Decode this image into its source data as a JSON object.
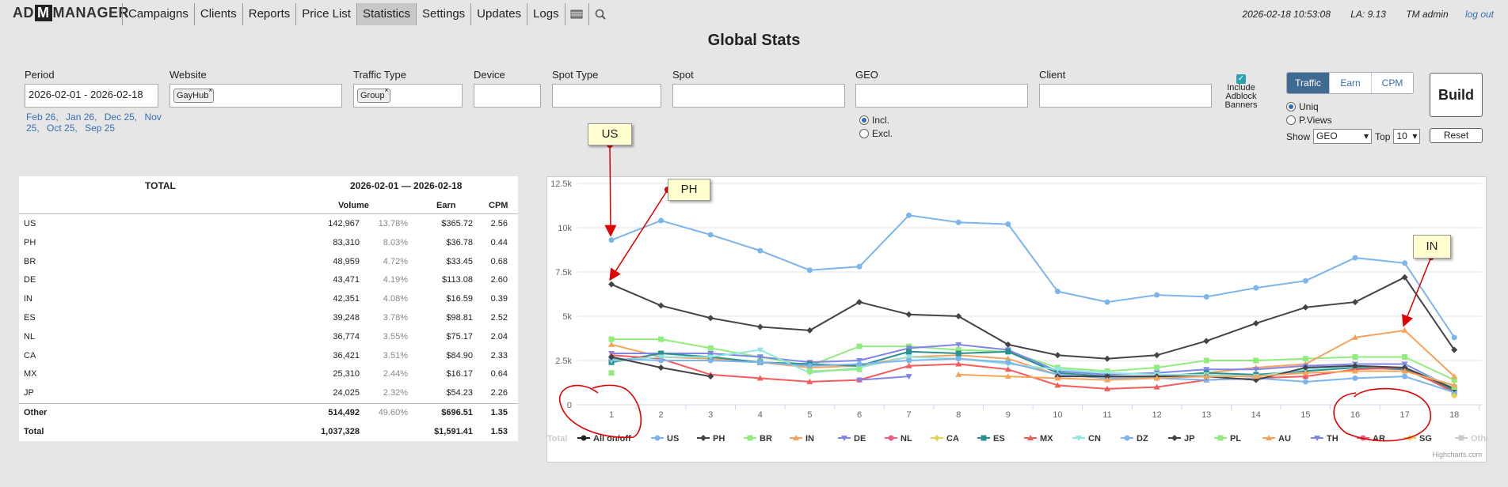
{
  "logo": {
    "pre": "AD",
    "mid": "M",
    "post": "MANAGER"
  },
  "nav": [
    {
      "label": "Campaigns",
      "active": false
    },
    {
      "label": "Clients",
      "active": false
    },
    {
      "label": "Reports",
      "active": false
    },
    {
      "label": "Price List",
      "active": false
    },
    {
      "label": "Statistics",
      "active": true
    },
    {
      "label": "Settings",
      "active": false
    },
    {
      "label": "Updates",
      "active": false
    },
    {
      "label": "Logs",
      "active": false
    }
  ],
  "nav_icons": [
    "table-icon",
    "search-icon"
  ],
  "header": {
    "datetime": "2026-02-18 10:53:08",
    "load": "LA: 9.13",
    "user": "TM admin",
    "logout": "log out"
  },
  "page_title": "Global Stats",
  "filters": {
    "period": {
      "label": "Period",
      "value": "2026-02-01 - 2026-02-18"
    },
    "website": {
      "label": "Website",
      "tag": "GayHub"
    },
    "traffic_type": {
      "label": "Traffic Type",
      "tag": "Group"
    },
    "device": {
      "label": "Device",
      "value": ""
    },
    "spot_type": {
      "label": "Spot Type",
      "value": ""
    },
    "spot": {
      "label": "Spot",
      "value": ""
    },
    "geo": {
      "label": "GEO",
      "value": ""
    },
    "client": {
      "label": "Client",
      "value": ""
    },
    "quick_periods": [
      "Feb 26,",
      "Jan 26,",
      "Dec 25,",
      "Nov 25,",
      "Oct 25,",
      "Sep 25"
    ],
    "geo_incl": "Incl.",
    "geo_excl": "Excl.",
    "adblock_label": "Include Adblock Banners",
    "adblock_checked": true
  },
  "controls": {
    "metric_tabs": [
      "Traffic",
      "Earn",
      "CPM"
    ],
    "active_tab": "Traffic",
    "count_options": [
      "Uniq",
      "P.Views"
    ],
    "count_selected": "Uniq",
    "show_label": "Show",
    "show_value": "GEO",
    "top_label": "Top",
    "top_value": "10",
    "build": "Build",
    "reset": "Reset"
  },
  "table": {
    "title": "TOTAL",
    "range": "2026-02-01 — 2026-02-18",
    "cols": {
      "volume": "Volume",
      "earn": "Earn",
      "cpm": "CPM"
    },
    "rows": [
      {
        "name": "US",
        "volume": "142,967",
        "pct": "13.78%",
        "earn": "$365.72",
        "cpm": "2.56"
      },
      {
        "name": "PH",
        "volume": "83,310",
        "pct": "8.03%",
        "earn": "$36.78",
        "cpm": "0.44"
      },
      {
        "name": "BR",
        "volume": "48,959",
        "pct": "4.72%",
        "earn": "$33.45",
        "cpm": "0.68"
      },
      {
        "name": "DE",
        "volume": "43,471",
        "pct": "4.19%",
        "earn": "$113.08",
        "cpm": "2.60"
      },
      {
        "name": "IN",
        "volume": "42,351",
        "pct": "4.08%",
        "earn": "$16.59",
        "cpm": "0.39"
      },
      {
        "name": "ES",
        "volume": "39,248",
        "pct": "3.78%",
        "earn": "$98.81",
        "cpm": "2.52"
      },
      {
        "name": "NL",
        "volume": "36,774",
        "pct": "3.55%",
        "earn": "$75.17",
        "cpm": "2.04"
      },
      {
        "name": "CA",
        "volume": "36,421",
        "pct": "3.51%",
        "earn": "$84.90",
        "cpm": "2.33"
      },
      {
        "name": "MX",
        "volume": "25,310",
        "pct": "2.44%",
        "earn": "$16.17",
        "cpm": "0.64"
      },
      {
        "name": "JP",
        "volume": "24,025",
        "pct": "2.32%",
        "earn": "$54.23",
        "cpm": "2.26"
      }
    ],
    "other": {
      "name": "Other",
      "volume": "514,492",
      "pct": "49.60%",
      "earn": "$696.51",
      "cpm": "1.35"
    },
    "total": {
      "name": "Total",
      "volume": "1,037,328",
      "pct": "",
      "earn": "$1,591.41",
      "cpm": "1.53"
    }
  },
  "annotations": [
    {
      "label": "US",
      "target": "US series, day 1"
    },
    {
      "label": "PH",
      "target": "PH series, day 1"
    },
    {
      "label": "IN",
      "target": "IN series, day 17"
    }
  ],
  "chart_data": {
    "type": "line",
    "x": [
      1,
      2,
      3,
      4,
      5,
      6,
      7,
      8,
      9,
      10,
      11,
      12,
      13,
      14,
      15,
      16,
      17,
      18
    ],
    "y_ticks": [
      "0",
      "2.5k",
      "5k",
      "7.5k",
      "10k",
      "12.5k"
    ],
    "ylim": [
      0,
      12500
    ],
    "credit": "Highcharts.com",
    "legend_toggle": "All on/off",
    "series": [
      {
        "name": "US",
        "color": "#7cb5ec",
        "values": [
          9300,
          10400,
          9600,
          8700,
          7600,
          7800,
          10700,
          10300,
          10200,
          6400,
          5800,
          6200,
          6100,
          6600,
          7000,
          8300,
          8000,
          3800
        ]
      },
      {
        "name": "PH",
        "color": "#434348",
        "values": [
          6800,
          5600,
          4900,
          4400,
          4200,
          5800,
          5100,
          5000,
          3400,
          2800,
          2600,
          2800,
          3600,
          4600,
          5500,
          5800,
          7200,
          3100
        ]
      },
      {
        "name": "BR",
        "color": "#90ed7d",
        "values": [
          3700,
          3700,
          3200,
          2700,
          2200,
          3300,
          3300,
          3100,
          3000,
          2100,
          1900,
          2100,
          2500,
          2500,
          2600,
          2700,
          2700,
          1400
        ]
      },
      {
        "name": "IN",
        "color": "#f7a35c",
        "values": [
          3400,
          2700,
          2600,
          2400,
          2100,
          2200,
          2700,
          2800,
          2600,
          1700,
          1500,
          1600,
          1800,
          2100,
          2300,
          3800,
          4200,
          1600
        ]
      },
      {
        "name": "DE",
        "color": "#8085e9",
        "values": [
          2900,
          2900,
          2900,
          2700,
          2400,
          2500,
          3200,
          3400,
          3100,
          1900,
          1700,
          1800,
          2000,
          2000,
          2200,
          2300,
          2300,
          900
        ]
      },
      {
        "name": "NL",
        "color": "#f15c80",
        "values": [
          null,
          null,
          null,
          null,
          null,
          null,
          null,
          null,
          null,
          null,
          null,
          null,
          null,
          null,
          null,
          null,
          null,
          null
        ]
      },
      {
        "name": "CA",
        "color": "#e4d354",
        "values": [
          null,
          null,
          null,
          null,
          null,
          null,
          null,
          null,
          null,
          null,
          null,
          null,
          null,
          null,
          null,
          null,
          null,
          null
        ]
      },
      {
        "name": "ES",
        "color": "#2b908f",
        "values": [
          2400,
          2900,
          2700,
          2400,
          2300,
          2200,
          3000,
          2900,
          3000,
          1800,
          1600,
          1600,
          1800,
          1700,
          1900,
          2100,
          2000,
          800
        ]
      },
      {
        "name": "MX",
        "color": "#f45b5b",
        "values": [
          2800,
          2600,
          1700,
          1500,
          1300,
          1400,
          2200,
          2300,
          2000,
          1100,
          900,
          1000,
          1400,
          1500,
          1600,
          2000,
          2100,
          700
        ]
      },
      {
        "name": "CN",
        "color": "#91e8e1",
        "values": [
          2500,
          2700,
          2700,
          3100,
          1800,
          2100,
          2700,
          2600,
          2300,
          2000,
          1800,
          1700,
          1700,
          1600,
          2000,
          2200,
          2100,
          1000
        ]
      },
      {
        "name": "DZ",
        "color": "#7cb5ec",
        "values": [
          2600,
          2500,
          2500,
          2400,
          2200,
          2300,
          2500,
          2600,
          2400,
          1700,
          1500,
          1500,
          1400,
          1500,
          1300,
          1500,
          1600,
          700
        ]
      },
      {
        "name": "JP",
        "color": "#434348",
        "values": [
          2700,
          2100,
          1600,
          null,
          null,
          null,
          null,
          null,
          null,
          1600,
          1600,
          1600,
          1600,
          1400,
          2100,
          2200,
          2100,
          900
        ]
      },
      {
        "name": "PL",
        "color": "#90ed7d",
        "values": [
          1800,
          null,
          null,
          null,
          1900,
          2000,
          null,
          null,
          null,
          null,
          null,
          null,
          null,
          null,
          null,
          null,
          null,
          1000
        ]
      },
      {
        "name": "AU",
        "color": "#f7a35c",
        "values": [
          null,
          null,
          null,
          null,
          null,
          null,
          null,
          1700,
          1600,
          1500,
          1400,
          1500,
          1600,
          1600,
          1800,
          1900,
          1900,
          1100
        ]
      },
      {
        "name": "TH",
        "color": "#8085e9",
        "values": [
          null,
          null,
          null,
          null,
          null,
          1400,
          1600,
          null,
          null,
          null,
          null,
          null,
          null,
          null,
          null,
          null,
          null,
          null
        ]
      },
      {
        "name": "AR",
        "color": "#f15c80",
        "values": [
          null,
          null,
          null,
          null,
          null,
          null,
          null,
          null,
          null,
          null,
          null,
          null,
          null,
          null,
          null,
          null,
          null,
          null
        ]
      },
      {
        "name": "SG",
        "color": "#e4d354",
        "values": [
          null,
          null,
          null,
          null,
          null,
          null,
          null,
          null,
          null,
          null,
          null,
          null,
          null,
          null,
          null,
          null,
          null,
          500
        ]
      },
      {
        "name": "Other",
        "color": "#cccccc",
        "values": [],
        "hidden": true
      },
      {
        "name": "Total",
        "color": "#cccccc",
        "values": [],
        "hidden": true
      }
    ]
  }
}
